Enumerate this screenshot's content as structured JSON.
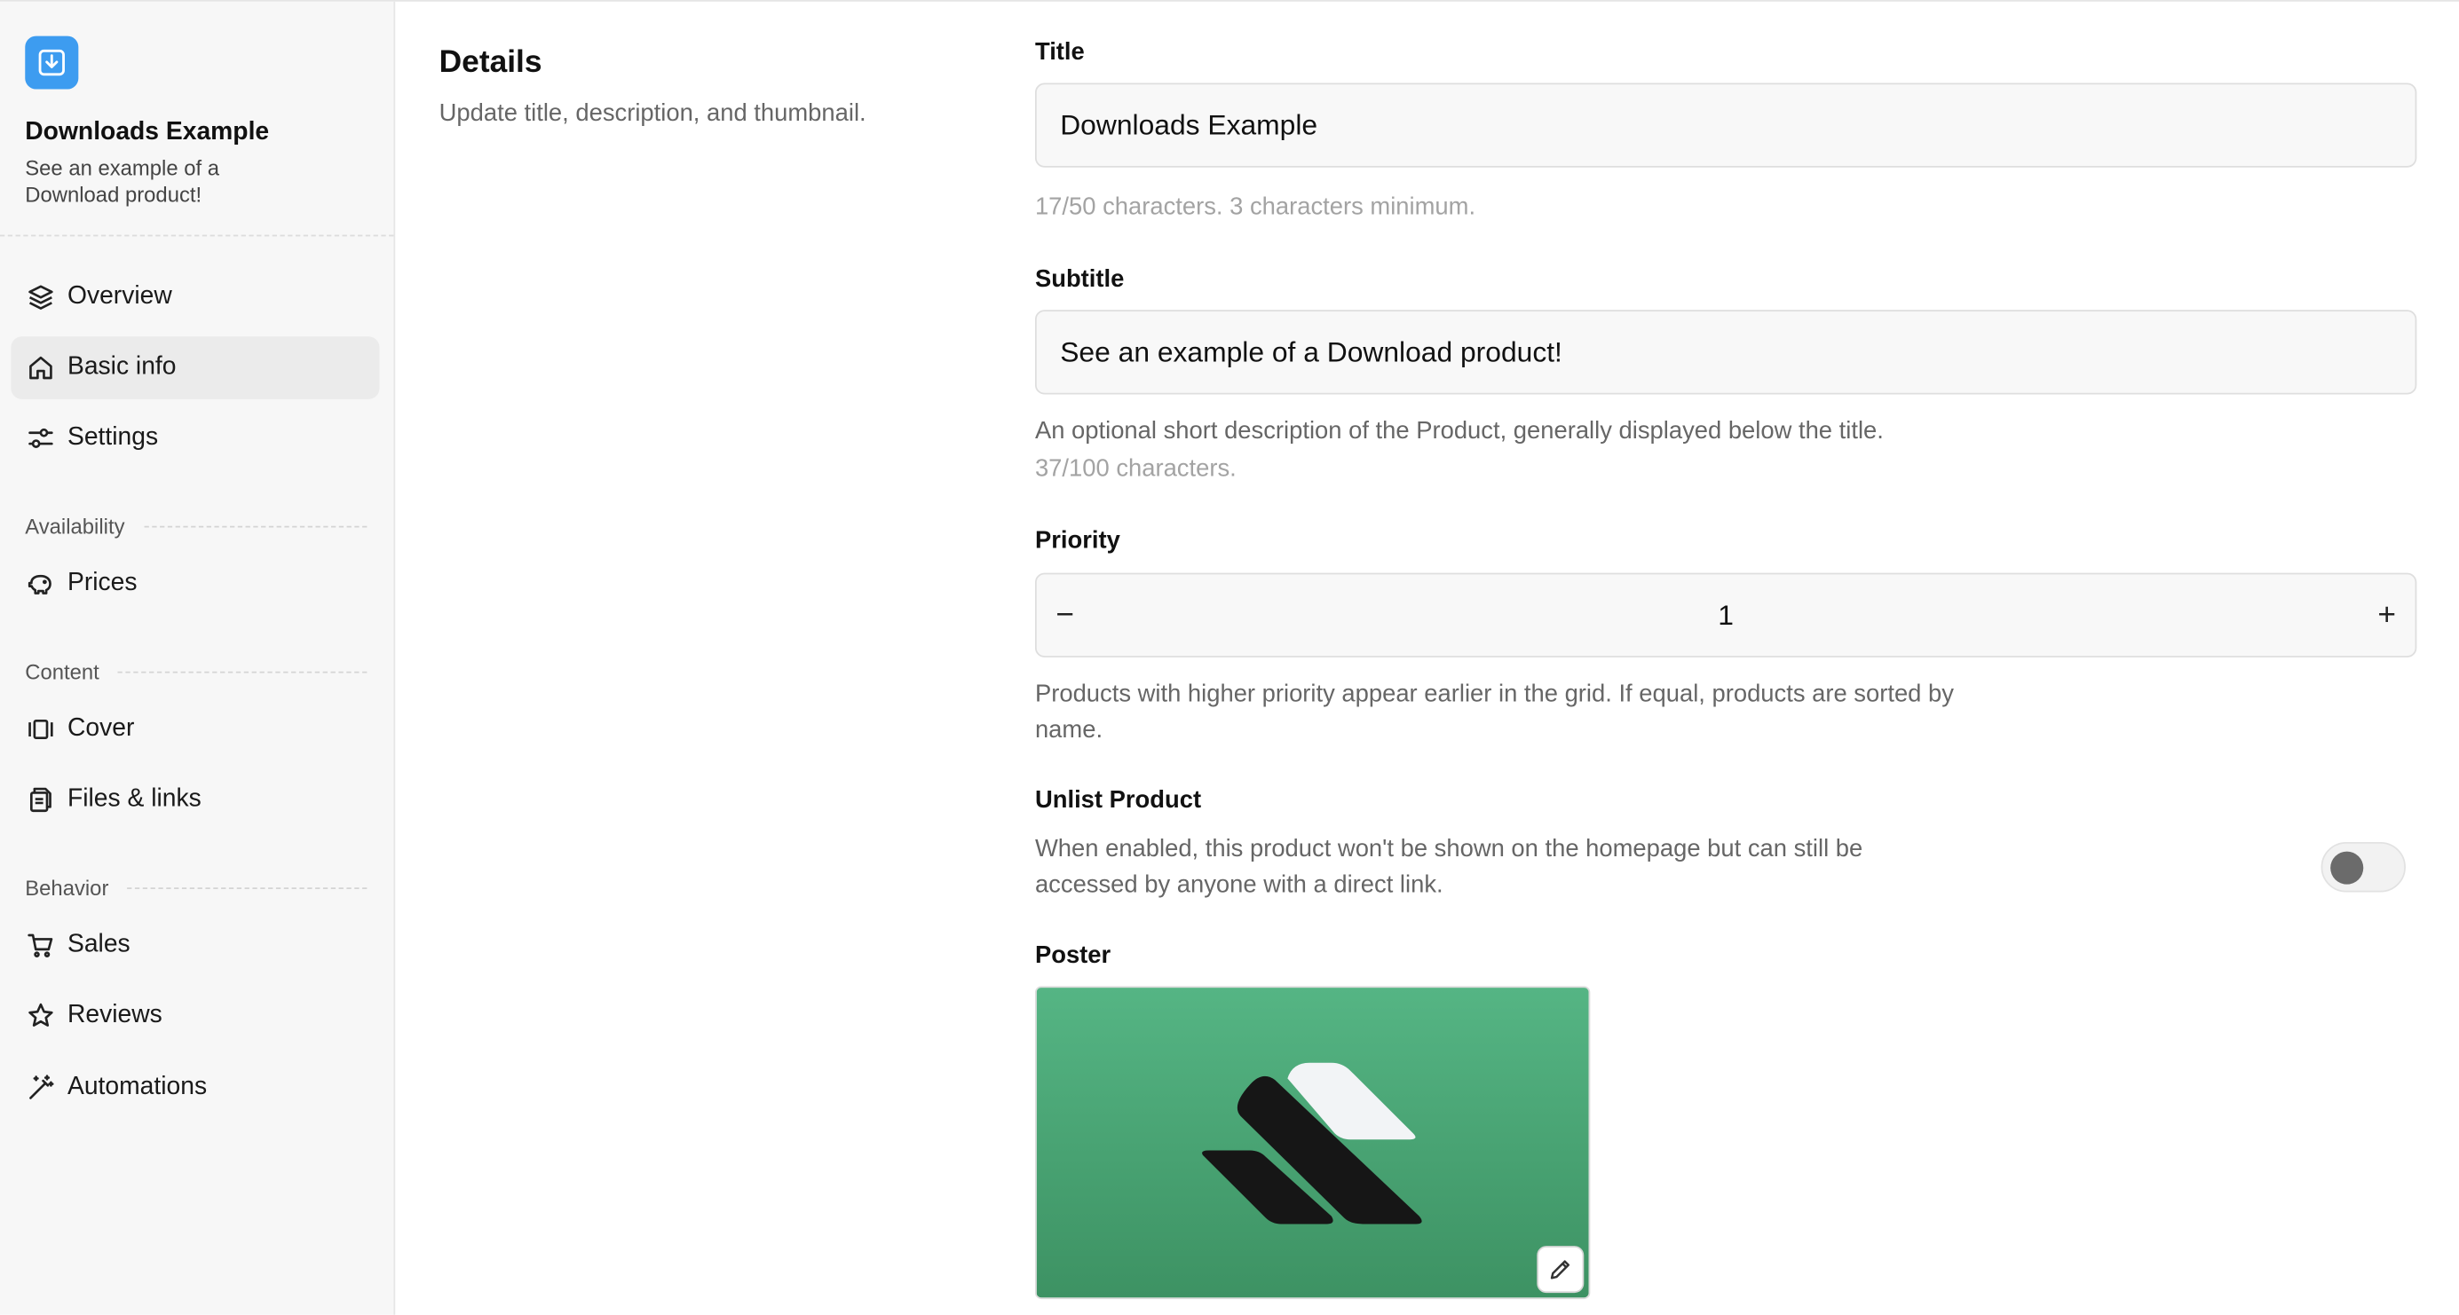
{
  "product": {
    "name": "Downloads Example",
    "subtitle": "See an example of a Download product!",
    "icon": "download-box-icon"
  },
  "sidebar": {
    "items": [
      {
        "label": "Overview",
        "icon": "layers-icon",
        "active": false
      },
      {
        "label": "Basic info",
        "icon": "home-icon",
        "active": true
      },
      {
        "label": "Settings",
        "icon": "sliders-icon",
        "active": false
      }
    ],
    "sections": [
      {
        "title": "Availability",
        "items": [
          {
            "label": "Prices",
            "icon": "piggy-bank-icon"
          }
        ]
      },
      {
        "title": "Content",
        "items": [
          {
            "label": "Cover",
            "icon": "gallery-icon"
          },
          {
            "label": "Files & links",
            "icon": "files-icon"
          }
        ]
      },
      {
        "title": "Behavior",
        "items": [
          {
            "label": "Sales",
            "icon": "cart-icon"
          },
          {
            "label": "Reviews",
            "icon": "star-icon"
          },
          {
            "label": "Automations",
            "icon": "magic-wand-icon"
          }
        ]
      }
    ]
  },
  "details": {
    "title": "Details",
    "subtitle": "Update title, description, and thumbnail."
  },
  "form": {
    "title": {
      "label": "Title",
      "value": "Downloads Example",
      "hint": "17/50 characters. 3 characters minimum."
    },
    "subtitle": {
      "label": "Subtitle",
      "value": "See an example of a Download product!",
      "hint": "An optional short description of the Product, generally displayed below the title.",
      "count": "37/100 characters."
    },
    "priority": {
      "label": "Priority",
      "value": "1",
      "minus": "−",
      "plus": "+",
      "hint_line1": "Products with higher priority appear earlier in the grid. If equal, products are sorted by",
      "hint_line2": "name."
    },
    "unlist": {
      "label": "Unlist Product",
      "hint_line1": "When enabled, this product won't be shown on the homepage but can still be",
      "hint_line2": "accessed by anyone with a direct link.",
      "enabled": false
    },
    "poster": {
      "label": "Poster",
      "edit_icon": "pencil-icon"
    }
  },
  "colors": {
    "accent": "#3d9cf0",
    "poster_top": "#55b584",
    "poster_bottom": "#3d9263"
  }
}
